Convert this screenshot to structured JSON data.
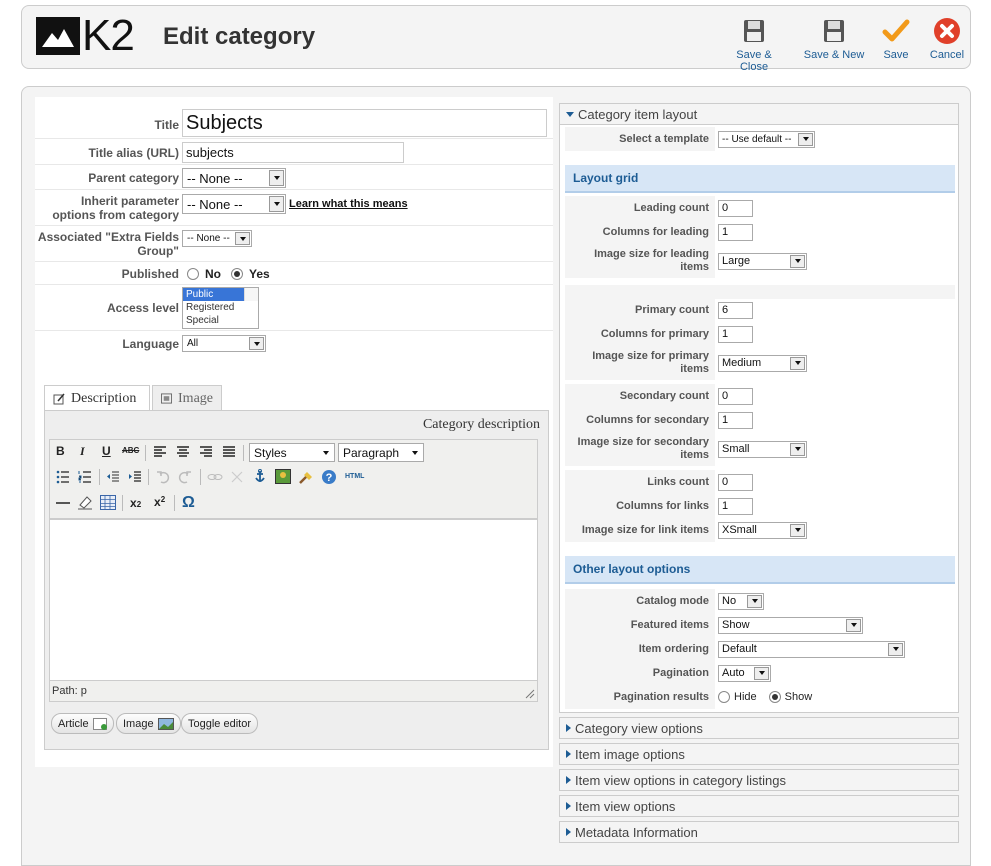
{
  "header": {
    "logo_text": "K2",
    "title": "Edit category",
    "toolbar": [
      {
        "label": "Save & Close",
        "icon": "floppy-icon"
      },
      {
        "label": "Save & New",
        "icon": "floppy-icon"
      },
      {
        "label": "Save",
        "icon": "check-icon"
      },
      {
        "label": "Cancel",
        "icon": "cancel-icon"
      }
    ]
  },
  "form": {
    "title_label": "Title",
    "title_value": "Subjects",
    "alias_label": "Title alias (URL)",
    "alias_value": "subjects",
    "parent_label": "Parent category",
    "parent_value": "-- None --",
    "inherit_label": "Inherit parameter options from category",
    "inherit_value": "-- None --",
    "inherit_link": "Learn what this means",
    "extra_label": "Associated \"Extra Fields Group\"",
    "extra_value": "-- None --",
    "published_label": "Published",
    "published_no": "No",
    "published_yes": "Yes",
    "access_label": "Access level",
    "access_options": [
      "Public",
      "Registered",
      "Special"
    ],
    "language_label": "Language",
    "language_value": "All"
  },
  "tabs": {
    "description": "Description",
    "image": "Image"
  },
  "editor": {
    "title": "Category description",
    "styles": "Styles",
    "paragraph": "Paragraph",
    "path": "Path: p",
    "buttons": {
      "article": "Article",
      "image": "Image",
      "toggle": "Toggle editor"
    },
    "tools": {
      "bold": "B",
      "italic": "I",
      "underline": "U",
      "strike": "ABC",
      "html": "HTML",
      "omega": "Ω"
    }
  },
  "right": {
    "category_item_layout": "Category item layout",
    "select_template_label": "Select a template",
    "select_template_value": "-- Use default --",
    "layout_grid": "Layout grid",
    "grid_rows": [
      {
        "label": "Leading count",
        "type": "num",
        "value": "0"
      },
      {
        "label": "Columns for leading",
        "type": "num",
        "value": "1"
      },
      {
        "label": "Image size for leading items",
        "type": "sel",
        "value": "Large"
      },
      {
        "label": "Primary count",
        "type": "num",
        "value": "6"
      },
      {
        "label": "Columns for primary",
        "type": "num",
        "value": "1"
      },
      {
        "label": "Image size for primary items",
        "type": "sel",
        "value": "Medium"
      },
      {
        "label": "Secondary count",
        "type": "num",
        "value": "0"
      },
      {
        "label": "Columns for secondary",
        "type": "num",
        "value": "1"
      },
      {
        "label": "Image size for secondary items",
        "type": "sel",
        "value": "Small"
      },
      {
        "label": "Links count",
        "type": "num",
        "value": "0"
      },
      {
        "label": "Columns for links",
        "type": "num",
        "value": "1"
      },
      {
        "label": "Image size for link items",
        "type": "sel",
        "value": "XSmall"
      }
    ],
    "other_layout_options": "Other layout options",
    "other_rows": [
      {
        "label": "Catalog mode",
        "value": "No"
      },
      {
        "label": "Featured items",
        "value": "Show"
      },
      {
        "label": "Item ordering",
        "value": "Default"
      },
      {
        "label": "Pagination",
        "value": "Auto"
      }
    ],
    "pagination_results_label": "Pagination results",
    "pagination_hide": "Hide",
    "pagination_show": "Show",
    "collapsed_sections": [
      "Category view options",
      "Item image options",
      "Item view options in category listings",
      "Item view options",
      "Metadata Information"
    ]
  },
  "colors": {
    "accent": "#1d5c94",
    "section_bg": "#d7e6f6",
    "save_orange": "#f29a1a",
    "cancel_red": "#e0402a"
  }
}
